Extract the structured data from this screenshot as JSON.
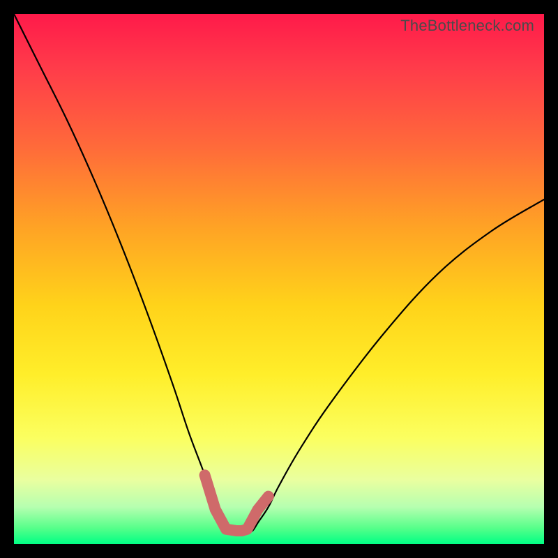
{
  "watermark": "TheBottleneck.com",
  "chart_data": {
    "type": "line",
    "title": "",
    "xlabel": "",
    "ylabel": "",
    "xlim": [
      0,
      100
    ],
    "ylim": [
      0,
      100
    ],
    "grid": false,
    "legend": false,
    "series": [
      {
        "name": "curve",
        "color": "#000000",
        "x": [
          0,
          5,
          10,
          15,
          20,
          25,
          30,
          33,
          36,
          38,
          39,
          40,
          42,
          43,
          44,
          45,
          46,
          48,
          50,
          54,
          60,
          70,
          80,
          90,
          100
        ],
        "values": [
          100,
          90,
          80,
          69,
          57,
          44,
          30,
          21,
          13,
          7,
          4,
          2.5,
          2.5,
          2.5,
          2.5,
          2.5,
          4,
          7,
          11,
          18,
          27,
          40,
          51,
          59,
          65
        ]
      },
      {
        "name": "highlight",
        "color": "#cf6a6a",
        "x": [
          36,
          38,
          40,
          42,
          43,
          44,
          46,
          48
        ],
        "values": [
          13,
          6.5,
          2.8,
          2.5,
          2.5,
          2.8,
          6.5,
          9
        ]
      }
    ],
    "annotations": [
      "TheBottleneck.com"
    ]
  }
}
